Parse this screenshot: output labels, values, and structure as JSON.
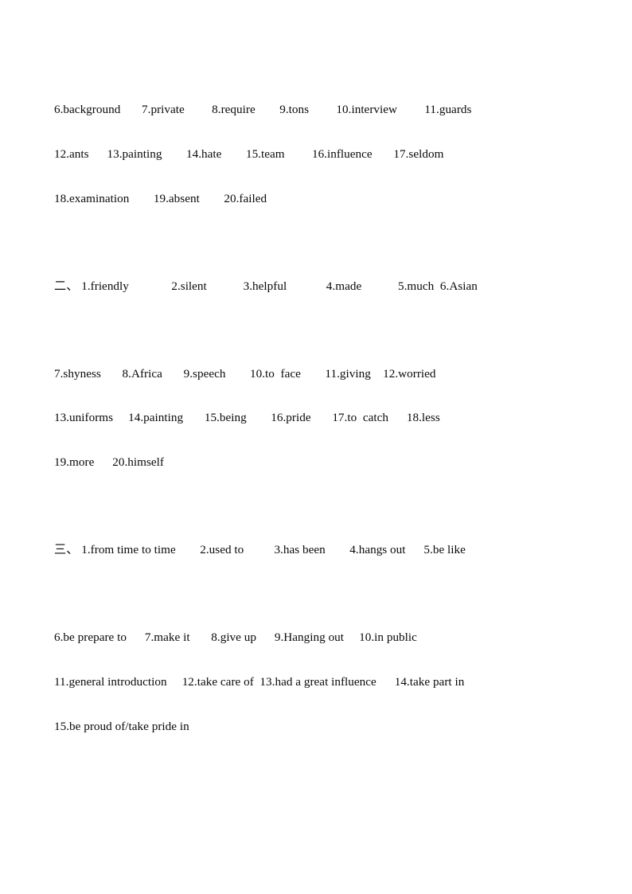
{
  "document": {
    "type": "answer-key",
    "page_background": "#ffffff",
    "text_color": "#0a0a0a",
    "blocks": [
      {
        "id": "block-1-continuation",
        "marker": "",
        "lines": [
          "6.background       7.private         8.require        9.tons         10.interview         11.guards",
          "12.ants      13.painting        14.hate        15.team         16.influence       17.seldom",
          "18.examination        19.absent        20.failed"
        ]
      },
      {
        "id": "block-2-lead",
        "marker": "二、",
        "lines": [
          "二、 1.friendly              2.silent            3.helpful             4.made            5.much  6.Asian"
        ]
      },
      {
        "id": "block-2-continuation",
        "marker": "",
        "lines": [
          "7.shyness       8.Africa       9.speech        10.to  face        11.giving    12.worried",
          "13.uniforms     14.painting       15.being        16.pride       17.to  catch      18.less",
          "19.more      20.himself"
        ]
      },
      {
        "id": "block-3-lead",
        "marker": "三、",
        "lines": [
          "三、 1.from time to time        2.used to          3.has been        4.hangs out      5.be like"
        ]
      },
      {
        "id": "block-3-continuation",
        "marker": "",
        "lines": [
          "6.be prepare to      7.make it       8.give up      9.Hanging out     10.in public",
          "11.general introduction     12.take care of  13.had a great influence      14.take part in",
          "15.be proud of/take pride in"
        ]
      }
    ],
    "answers": {
      "section_one_continued": [
        {
          "number": "6",
          "answer": "background"
        },
        {
          "number": "7",
          "answer": "private"
        },
        {
          "number": "8",
          "answer": "require"
        },
        {
          "number": "9",
          "answer": "tons"
        },
        {
          "number": "10",
          "answer": "interview"
        },
        {
          "number": "11",
          "answer": "guards"
        },
        {
          "number": "12",
          "answer": "ants"
        },
        {
          "number": "13",
          "answer": "painting"
        },
        {
          "number": "14",
          "answer": "hate"
        },
        {
          "number": "15",
          "answer": "team"
        },
        {
          "number": "16",
          "answer": "influence"
        },
        {
          "number": "17",
          "answer": "seldom"
        },
        {
          "number": "18",
          "answer": "examination"
        },
        {
          "number": "19",
          "answer": "absent"
        },
        {
          "number": "20",
          "answer": "failed"
        }
      ],
      "section_two": [
        {
          "number": "1",
          "answer": "friendly"
        },
        {
          "number": "2",
          "answer": "silent"
        },
        {
          "number": "3",
          "answer": "helpful"
        },
        {
          "number": "4",
          "answer": "made"
        },
        {
          "number": "5",
          "answer": "much"
        },
        {
          "number": "6",
          "answer": "Asian"
        },
        {
          "number": "7",
          "answer": "shyness"
        },
        {
          "number": "8",
          "answer": "Africa"
        },
        {
          "number": "9",
          "answer": "speech"
        },
        {
          "number": "10",
          "answer": "to  face"
        },
        {
          "number": "11",
          "answer": "giving"
        },
        {
          "number": "12",
          "answer": "worried"
        },
        {
          "number": "13",
          "answer": "uniforms"
        },
        {
          "number": "14",
          "answer": "painting"
        },
        {
          "number": "15",
          "answer": "being"
        },
        {
          "number": "16",
          "answer": "pride"
        },
        {
          "number": "17",
          "answer": "to  catch"
        },
        {
          "number": "18",
          "answer": "less"
        },
        {
          "number": "19",
          "answer": "more"
        },
        {
          "number": "20",
          "answer": "himself"
        }
      ],
      "section_three": [
        {
          "number": "1",
          "answer": "from time to time"
        },
        {
          "number": "2",
          "answer": "used to"
        },
        {
          "number": "3",
          "answer": "has been"
        },
        {
          "number": "4",
          "answer": "hangs out"
        },
        {
          "number": "5",
          "answer": "be like"
        },
        {
          "number": "6",
          "answer": "be prepare to"
        },
        {
          "number": "7",
          "answer": "make it"
        },
        {
          "number": "8",
          "answer": "give up"
        },
        {
          "number": "9",
          "answer": "Hanging out"
        },
        {
          "number": "10",
          "answer": "in public"
        },
        {
          "number": "11",
          "answer": "general introduction"
        },
        {
          "number": "12",
          "answer": "take care of"
        },
        {
          "number": "13",
          "answer": "had a great influence"
        },
        {
          "number": "14",
          "answer": "take part in"
        },
        {
          "number": "15",
          "answer": "be proud of/take pride in"
        }
      ]
    }
  }
}
